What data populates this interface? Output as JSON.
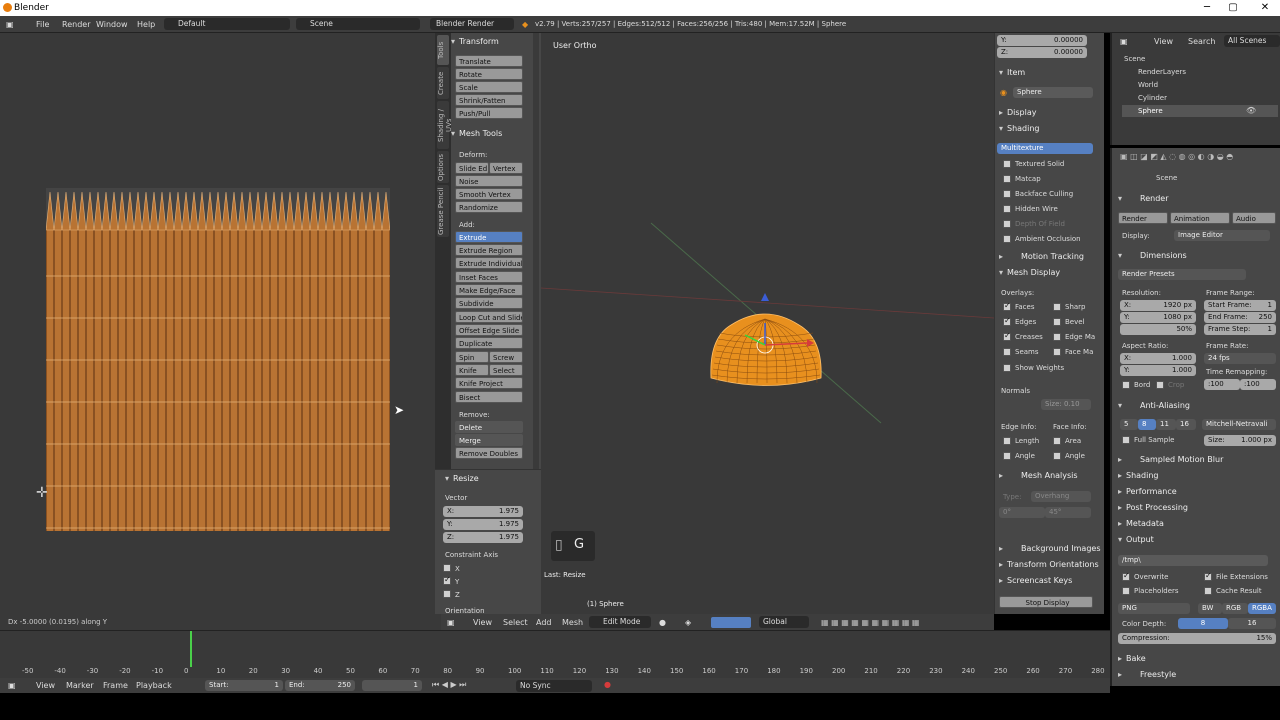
{
  "window": {
    "title": "Blender"
  },
  "info_header": {
    "menus": [
      "File",
      "Render",
      "Window",
      "Help"
    ],
    "layout": "Default",
    "scene": "Scene",
    "engine": "Blender Render",
    "stats": "v2.79 | Verts:257/257 | Edges:512/512 | Faces:256/256 | Tris:480 | Mem:17.52M | Sphere"
  },
  "uv_editor": {
    "status": "Dx -5.0000 (0.0195) along Y"
  },
  "tool_tabs": [
    "Tools",
    "Create",
    "Shading / UVs",
    "Options",
    "Grease Pencil"
  ],
  "tool_shelf": {
    "transform": {
      "title": "Transform",
      "buttons": [
        "Translate",
        "Rotate",
        "Scale",
        "Shrink/Fatten",
        "Push/Pull"
      ]
    },
    "mesh_tools": {
      "title": "Mesh Tools",
      "deform_label": "Deform:",
      "deform": [
        "Slide Ed",
        "Vertex",
        "Noise",
        "Smooth Vertex",
        "Randomize"
      ],
      "add_label": "Add:",
      "add": [
        "Extrude",
        "Extrude Region",
        "Extrude Individual",
        "Inset Faces",
        "Make Edge/Face",
        "Subdivide",
        "Loop Cut and Slide",
        "Offset Edge Slide",
        "Duplicate",
        "Spin",
        "Screw",
        "Knife",
        "Select",
        "Knife Project",
        "Bisect"
      ],
      "remove_label": "Remove:",
      "remove": [
        "Delete",
        "Merge",
        "Remove Doubles"
      ]
    }
  },
  "redo_panel": {
    "title": "Resize",
    "vector_label": "Vector",
    "x": "X:",
    "x_val": "1.975",
    "y": "Y:",
    "y_val": "1.975",
    "z": "Z:",
    "z_val": "1.975",
    "constraint_label": "Constraint Axis",
    "axes": [
      "X",
      "Y",
      "Z"
    ],
    "orientation_label": "Orientation"
  },
  "viewport": {
    "label": "User Ortho",
    "object_label": "(1) Sphere",
    "key_hint": "G",
    "last_op": "Last: Resize"
  },
  "viewport_header": {
    "menus": [
      "View",
      "Select",
      "Add",
      "Mesh"
    ],
    "mode": "Edit Mode",
    "orientation": "Global"
  },
  "n_panel": {
    "transform_y": "Y:",
    "transform_y_val": "0.00000",
    "transform_z": "Z:",
    "transform_z_val": "0.00000",
    "item": "Item",
    "item_name": "Sphere",
    "display": "Display",
    "shading": "Shading",
    "shading_mode": "Multitexture",
    "shading_opts": [
      "Textured Solid",
      "Matcap",
      "Backface Culling",
      "Hidden Wire",
      "Depth Of Field",
      "Ambient Occlusion"
    ],
    "motion_tracking": "Motion Tracking",
    "mesh_display": "Mesh Display",
    "overlays": "Overlays:",
    "overlay_opts": [
      "Faces",
      "Sharp",
      "Edges",
      "Bevel",
      "Creases",
      "Edge Ma",
      "Seams",
      "Face Ma",
      "Show Weights"
    ],
    "normals": "Normals",
    "normals_size": "Size: 0.10",
    "edge_info": "Edge Info:",
    "face_info": "Face Info:",
    "info_opts": [
      "Length",
      "Area",
      "Angle",
      "Angle"
    ],
    "mesh_analysis": "Mesh Analysis",
    "analysis_type": "Type:",
    "analysis_type_val": "Overhang",
    "analysis_range": [
      "0°",
      "45°"
    ],
    "background_images": "Background Images",
    "transform_orientations": "Transform Orientations",
    "screencast_keys": "Screencast Keys",
    "stop_display": "Stop Display"
  },
  "outliner": {
    "menus": [
      "View",
      "Search"
    ],
    "filter": "All Scenes",
    "items": [
      "Scene",
      "RenderLayers",
      "World",
      "Cylinder",
      "Sphere"
    ]
  },
  "properties": {
    "breadcrumb": "Scene",
    "render": "Render",
    "render_btns": [
      "Render",
      "Animation",
      "Audio"
    ],
    "display": "Display:",
    "display_val": "Image Editor",
    "dimensions": "Dimensions",
    "presets": "Render Presets",
    "resolution": "Resolution:",
    "res_x": "X:",
    "res_x_val": "1920 px",
    "res_y": "Y:",
    "res_y_val": "1080 px",
    "res_pct": "50%",
    "frame_range": "Frame Range:",
    "start": "Start Frame:",
    "start_val": "1",
    "end": "End Frame:",
    "end_val": "250",
    "step": "Frame Step:",
    "step_val": "1",
    "aspect": "Aspect Ratio:",
    "asp_x_val": "1.000",
    "asp_y_val": "1.000",
    "frame_rate": "Frame Rate:",
    "fps": "24 fps",
    "time_remap": "Time Remapping:",
    "remap_old": ":100",
    "remap_new": ":100",
    "border": "Bord",
    "crop": "Crop",
    "anti_aliasing": "Anti-Aliasing",
    "aa_samples": [
      "5",
      "8",
      "11",
      "16"
    ],
    "aa_filter": "Mitchell-Netravali",
    "full_sample": "Full Sample",
    "aa_size": "Size:",
    "aa_size_val": "1.000 px",
    "collapsed": [
      "Sampled Motion Blur",
      "Shading",
      "Performance",
      "Post Processing",
      "Metadata"
    ],
    "output": "Output",
    "output_path": "/tmp\\",
    "overwrite": "Overwrite",
    "file_ext": "File Extensions",
    "placeholders": "Placeholders",
    "cache_result": "Cache Result",
    "format": "PNG",
    "color_modes": [
      "BW",
      "RGB",
      "RGBA"
    ],
    "color_depth": "Color Depth:",
    "depths": [
      "8",
      "16"
    ],
    "compression": "Compression:",
    "compression_val": "15%",
    "bake": "Bake",
    "freestyle": "Freestyle"
  },
  "timeline": {
    "ticks": [
      "-50",
      "-40",
      "-30",
      "-20",
      "-10",
      "0",
      "10",
      "20",
      "30",
      "40",
      "50",
      "60",
      "70",
      "80",
      "90",
      "100",
      "110",
      "120",
      "130",
      "140",
      "150",
      "160",
      "170",
      "180",
      "190",
      "200",
      "210",
      "220",
      "230",
      "240",
      "250",
      "260",
      "270",
      "280"
    ],
    "menus": [
      "View",
      "Marker",
      "Frame",
      "Playback"
    ],
    "start": "Start:",
    "start_val": "1",
    "end": "End:",
    "end_val": "250",
    "current": "1",
    "sync": "No Sync"
  },
  "colors": {
    "accent": "#5680c2",
    "mesh": "#e8901e",
    "uv_face": "#b87333"
  }
}
